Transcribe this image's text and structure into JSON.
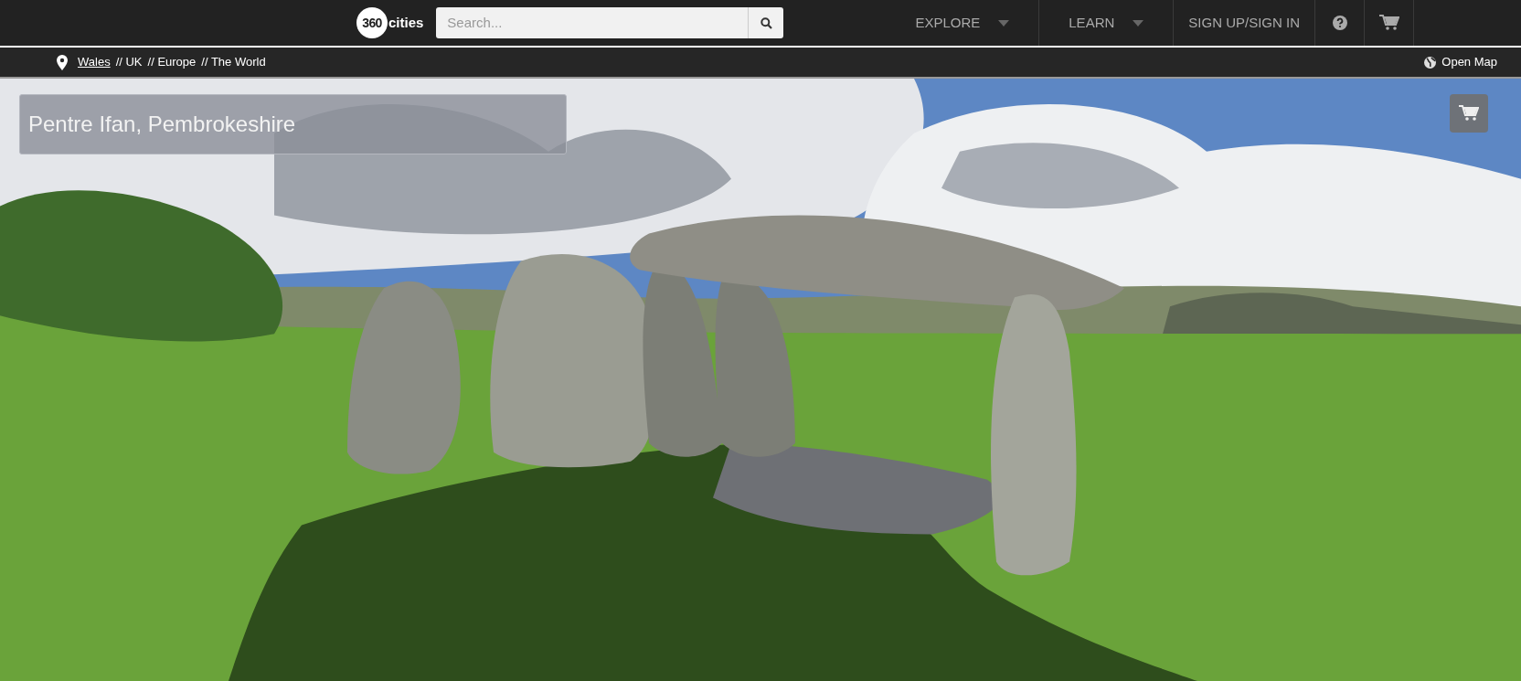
{
  "header": {
    "logo": {
      "badge": "360",
      "word": "cities"
    },
    "search": {
      "placeholder": "Search..."
    },
    "nav": [
      {
        "kind": "dropdown",
        "label": "EXPLORE"
      },
      {
        "kind": "dropdown",
        "label": "LEARN"
      },
      {
        "kind": "link",
        "label": "SIGN UP/SIGN IN"
      },
      {
        "kind": "help"
      },
      {
        "kind": "cart"
      }
    ]
  },
  "breadcrumb": {
    "items": [
      {
        "label": "Wales",
        "link": true
      },
      {
        "label": "// UK",
        "link": false
      },
      {
        "label": "// Europe",
        "link": false
      },
      {
        "label": "// The World",
        "link": false
      }
    ],
    "open_map": "Open Map"
  },
  "panorama": {
    "title": "Pentre Ifan, Pembrokeshire"
  }
}
